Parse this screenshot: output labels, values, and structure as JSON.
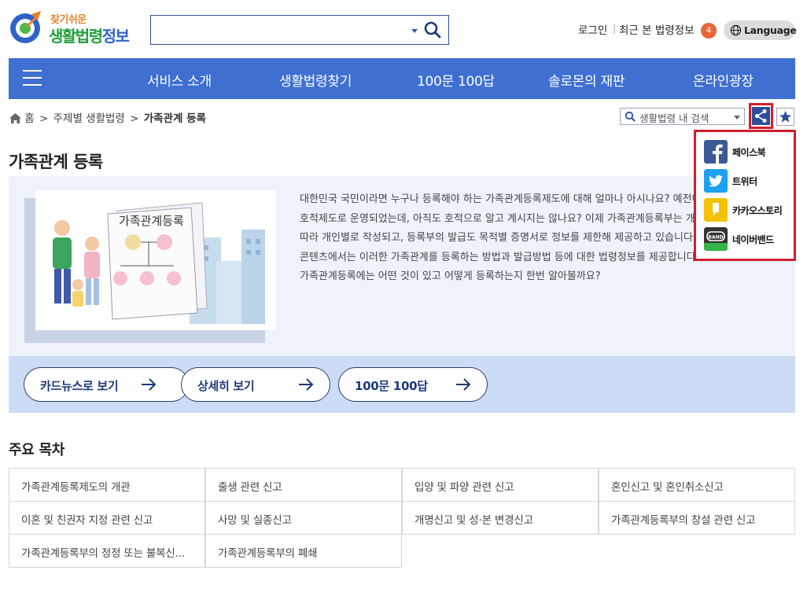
{
  "logo": {
    "line1": "찾기쉬운",
    "line2a": "생활법령",
    "line2b": "정보"
  },
  "search": {
    "value": "",
    "placeholder": ""
  },
  "util": {
    "login": "로그인",
    "separator": "|",
    "recent": "최근 본 법령정보",
    "recent_count": "4",
    "language": "Language"
  },
  "nav": {
    "items": [
      "서비스 소개",
      "생활법령찾기",
      "100문 100답",
      "솔로몬의 재판",
      "온라인광장"
    ]
  },
  "breadcrumb": {
    "home": "홈",
    "sep": ">",
    "level1": "주제별 생활법령",
    "current": "가족관계 등록"
  },
  "inner_search": {
    "label": "생활법령 내 검색"
  },
  "share": {
    "items": [
      {
        "label": "페이스북",
        "icon": "facebook-icon",
        "color": "#3b5998"
      },
      {
        "label": "트위터",
        "icon": "twitter-icon",
        "color": "#1da1f2"
      },
      {
        "label": "카카오스토리",
        "icon": "kakaostory-icon",
        "color": "#f2c300"
      },
      {
        "label": "네이버밴드",
        "icon": "band-icon",
        "color": "#37b34a"
      }
    ]
  },
  "page": {
    "title": "가족관계 등록"
  },
  "intro": {
    "illustration_text": "가족관계등록",
    "lines": [
      "대한민국 국민이라면 누구나 등록해야 하는 가족관계등록제도에 대해 얼마나 아시나요? 예전에는",
      "호적제도로 운영되었는데, 아직도 호적으로 알고 계시지는 않나요? 이제 가족관계등록부는 개인별",
      "따라 개인별로 작성되고, 등록부의 발급도 목적별 증명서로 정보를 제한해 제공하고 있습니다. 이",
      "콘텐츠에서는 이러한 가족관계를 등록하는 방법과 발급방법 등에 대한 법령정보를 제공합니다.",
      "가족관계등록에는 어떤 것이 있고 어떻게 등록하는지 한번 알아볼까요?"
    ]
  },
  "buttons": {
    "card_news": "카드뉴스로 보기",
    "detail": "상세히 보기",
    "qa": "100문 100답"
  },
  "toc": {
    "title": "주요 목차",
    "items": [
      "가족관계등록제도의 개관",
      "출생 관련 신고",
      "입양 및 파양 관련 신고",
      "혼인신고 및 혼인취소신고",
      "이혼 및 친권자 지정 관련 신고",
      "사망 및 실종신고",
      "개명신고 및 성·본 변경신고",
      "가족관계등록부의 창설 관련 신고",
      "가족관계등록부의 정정 또는 불복신...",
      "가족관계등록부의 폐쇄"
    ]
  },
  "colors": {
    "nav": "#3f6fd1",
    "highlight": "#d11f2d",
    "panel": "#eef3fb",
    "strip": "#ccdcf4"
  }
}
